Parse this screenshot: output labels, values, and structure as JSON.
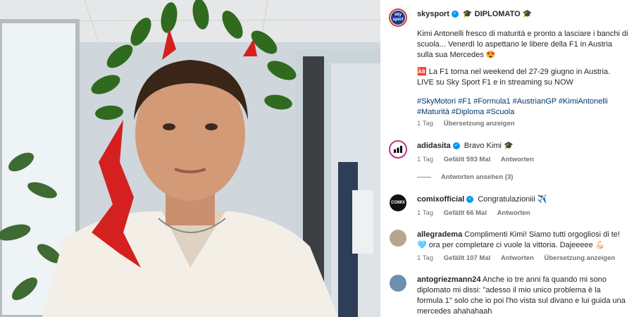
{
  "post": {
    "author": "skysport",
    "author_suffix": "🎓 DIPLOMATO 🎓",
    "avatar_label": "sky sport",
    "caption_1": "Kimi Antonelli fresco di maturità e pronto a lasciare i banchi di scuola... Venerdì lo aspettano le libere della F1 in Austria sulla sua Mercedes 😍",
    "caption_2": "🆎 La F1 torna nel weekend del 27-29 giugno in Austria. LIVE su Sky Sport F1 e in streaming su NOW",
    "hashtags": "#SkyMotori #F1 #Formula1 #AustrianGP #KimiAntonelli #Maturità #Diploma #Scuola",
    "time": "1 Tag",
    "translate": "Übersetzung anzeigen"
  },
  "comments": [
    {
      "username": "adidasita",
      "text": "Bravo Kimi 🎓",
      "time": "1 Tag",
      "likes": "Gefällt 593 Mal",
      "reply": "Antworten",
      "replies_label": "Antworten ansehen (3)"
    },
    {
      "username": "comixofficial",
      "text": "Congratulazioniii ✈️",
      "avatar_label": "COMIX",
      "time": "1 Tag",
      "likes": "Gefällt 66 Mal",
      "reply": "Antworten"
    },
    {
      "username": "allegradema",
      "text": "Complimenti Kimi! Siamo tutti orgogliosi di te! 🩵 ora per completare ci vuole la vittoria. Dajeeeee 💪🏻",
      "time": "1 Tag",
      "likes": "Gefällt 107 Mal",
      "reply": "Antworten",
      "translate": "Übersetzung anzeigen"
    },
    {
      "username": "antogriezmann24",
      "text": "Anche io tre anni fa quando mi sono diplomato mi dissi: \"adesso il mio unico problema è la formula 1\" solo che io poi l'ho vista sul divano e lui guida una mercedes ahahahaah"
    }
  ],
  "colors": {
    "link": "#00376b",
    "verified": "#0095f6",
    "meta": "#737373"
  }
}
